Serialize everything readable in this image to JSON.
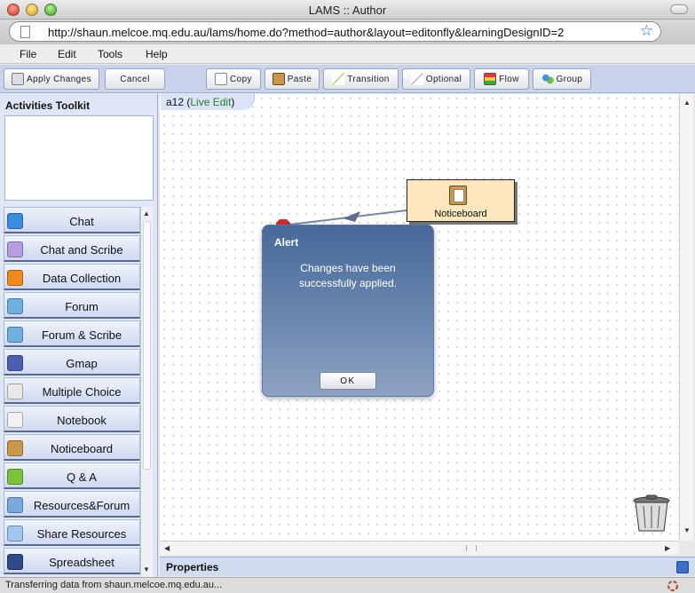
{
  "window": {
    "title": "LAMS :: Author"
  },
  "browser": {
    "url": "http://shaun.melcoe.mq.edu.au/lams/home.do?method=author&layout=editonfly&learningDesignID=2"
  },
  "menu": [
    "File",
    "Edit",
    "Tools",
    "Help"
  ],
  "toolbar": {
    "apply_changes": "Apply Changes",
    "cancel": "Cancel",
    "copy": "Copy",
    "paste": "Paste",
    "transition": "Transition",
    "optional": "Optional",
    "flow": "Flow",
    "group": "Group"
  },
  "toolkit": {
    "title": "Activities Toolkit",
    "items": [
      {
        "label": "Chat",
        "icon": "chat-bubble-icon",
        "color": "#3a8de0"
      },
      {
        "label": "Chat and Scribe",
        "icon": "chat-scribe-icon",
        "color": "#b69ce0"
      },
      {
        "label": "Data Collection",
        "icon": "database-icon",
        "color": "#f08a1c"
      },
      {
        "label": "Forum",
        "icon": "forum-people-icon",
        "color": "#6fb0e0"
      },
      {
        "label": "Forum & Scribe",
        "icon": "forum-scribe-icon",
        "color": "#6fb0e0"
      },
      {
        "label": "Gmap",
        "icon": "compass-icon",
        "color": "#4a5fb0"
      },
      {
        "label": "Multiple Choice",
        "icon": "checklist-icon",
        "color": "#e8e8e8"
      },
      {
        "label": "Notebook",
        "icon": "notebook-icon",
        "color": "#f2f2f2"
      },
      {
        "label": "Noticeboard",
        "icon": "noticeboard-icon",
        "color": "#c8994c"
      },
      {
        "label": "Q & A",
        "icon": "question-icon",
        "color": "#7cc23d"
      },
      {
        "label": "Resources&Forum",
        "icon": "resources-forum-icon",
        "color": "#7aa8e0"
      },
      {
        "label": "Share Resources",
        "icon": "share-resources-icon",
        "color": "#9fc6ee"
      },
      {
        "label": "Spreadsheet",
        "icon": "spreadsheet-icon",
        "color": "#2e4a8a"
      }
    ]
  },
  "canvas": {
    "design_name": "a12",
    "mode": "Live Edit",
    "activity_label": "Noticeboard"
  },
  "alert": {
    "title": "Alert",
    "message": "Changes have been successfully applied.",
    "ok": "OK"
  },
  "properties": {
    "title": "Properties"
  },
  "status": {
    "text": "Transferring data from shaun.melcoe.mq.edu.au..."
  }
}
